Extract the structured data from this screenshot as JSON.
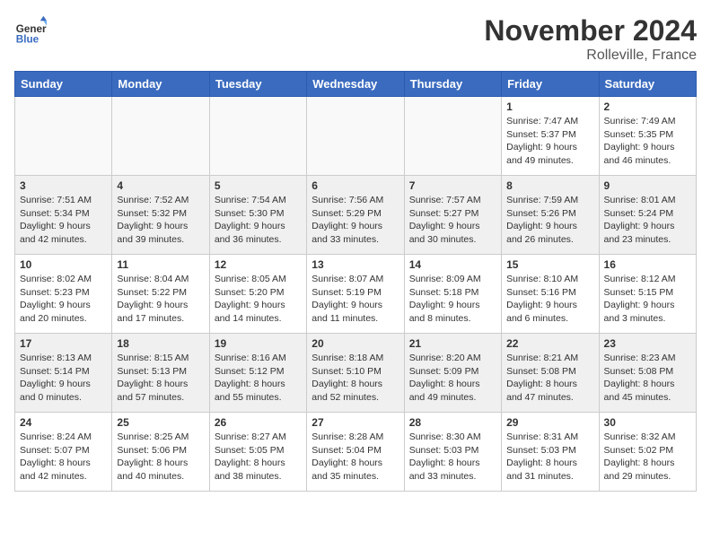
{
  "header": {
    "logo_line1": "General",
    "logo_line2": "Blue",
    "month_title": "November 2024",
    "location": "Rolleville, France"
  },
  "weekdays": [
    "Sunday",
    "Monday",
    "Tuesday",
    "Wednesday",
    "Thursday",
    "Friday",
    "Saturday"
  ],
  "weeks": [
    [
      {
        "day": "",
        "info": ""
      },
      {
        "day": "",
        "info": ""
      },
      {
        "day": "",
        "info": ""
      },
      {
        "day": "",
        "info": ""
      },
      {
        "day": "",
        "info": ""
      },
      {
        "day": "1",
        "info": "Sunrise: 7:47 AM\nSunset: 5:37 PM\nDaylight: 9 hours\nand 49 minutes."
      },
      {
        "day": "2",
        "info": "Sunrise: 7:49 AM\nSunset: 5:35 PM\nDaylight: 9 hours\nand 46 minutes."
      }
    ],
    [
      {
        "day": "3",
        "info": "Sunrise: 7:51 AM\nSunset: 5:34 PM\nDaylight: 9 hours\nand 42 minutes."
      },
      {
        "day": "4",
        "info": "Sunrise: 7:52 AM\nSunset: 5:32 PM\nDaylight: 9 hours\nand 39 minutes."
      },
      {
        "day": "5",
        "info": "Sunrise: 7:54 AM\nSunset: 5:30 PM\nDaylight: 9 hours\nand 36 minutes."
      },
      {
        "day": "6",
        "info": "Sunrise: 7:56 AM\nSunset: 5:29 PM\nDaylight: 9 hours\nand 33 minutes."
      },
      {
        "day": "7",
        "info": "Sunrise: 7:57 AM\nSunset: 5:27 PM\nDaylight: 9 hours\nand 30 minutes."
      },
      {
        "day": "8",
        "info": "Sunrise: 7:59 AM\nSunset: 5:26 PM\nDaylight: 9 hours\nand 26 minutes."
      },
      {
        "day": "9",
        "info": "Sunrise: 8:01 AM\nSunset: 5:24 PM\nDaylight: 9 hours\nand 23 minutes."
      }
    ],
    [
      {
        "day": "10",
        "info": "Sunrise: 8:02 AM\nSunset: 5:23 PM\nDaylight: 9 hours\nand 20 minutes."
      },
      {
        "day": "11",
        "info": "Sunrise: 8:04 AM\nSunset: 5:22 PM\nDaylight: 9 hours\nand 17 minutes."
      },
      {
        "day": "12",
        "info": "Sunrise: 8:05 AM\nSunset: 5:20 PM\nDaylight: 9 hours\nand 14 minutes."
      },
      {
        "day": "13",
        "info": "Sunrise: 8:07 AM\nSunset: 5:19 PM\nDaylight: 9 hours\nand 11 minutes."
      },
      {
        "day": "14",
        "info": "Sunrise: 8:09 AM\nSunset: 5:18 PM\nDaylight: 9 hours\nand 8 minutes."
      },
      {
        "day": "15",
        "info": "Sunrise: 8:10 AM\nSunset: 5:16 PM\nDaylight: 9 hours\nand 6 minutes."
      },
      {
        "day": "16",
        "info": "Sunrise: 8:12 AM\nSunset: 5:15 PM\nDaylight: 9 hours\nand 3 minutes."
      }
    ],
    [
      {
        "day": "17",
        "info": "Sunrise: 8:13 AM\nSunset: 5:14 PM\nDaylight: 9 hours\nand 0 minutes."
      },
      {
        "day": "18",
        "info": "Sunrise: 8:15 AM\nSunset: 5:13 PM\nDaylight: 8 hours\nand 57 minutes."
      },
      {
        "day": "19",
        "info": "Sunrise: 8:16 AM\nSunset: 5:12 PM\nDaylight: 8 hours\nand 55 minutes."
      },
      {
        "day": "20",
        "info": "Sunrise: 8:18 AM\nSunset: 5:10 PM\nDaylight: 8 hours\nand 52 minutes."
      },
      {
        "day": "21",
        "info": "Sunrise: 8:20 AM\nSunset: 5:09 PM\nDaylight: 8 hours\nand 49 minutes."
      },
      {
        "day": "22",
        "info": "Sunrise: 8:21 AM\nSunset: 5:08 PM\nDaylight: 8 hours\nand 47 minutes."
      },
      {
        "day": "23",
        "info": "Sunrise: 8:23 AM\nSunset: 5:08 PM\nDaylight: 8 hours\nand 45 minutes."
      }
    ],
    [
      {
        "day": "24",
        "info": "Sunrise: 8:24 AM\nSunset: 5:07 PM\nDaylight: 8 hours\nand 42 minutes."
      },
      {
        "day": "25",
        "info": "Sunrise: 8:25 AM\nSunset: 5:06 PM\nDaylight: 8 hours\nand 40 minutes."
      },
      {
        "day": "26",
        "info": "Sunrise: 8:27 AM\nSunset: 5:05 PM\nDaylight: 8 hours\nand 38 minutes."
      },
      {
        "day": "27",
        "info": "Sunrise: 8:28 AM\nSunset: 5:04 PM\nDaylight: 8 hours\nand 35 minutes."
      },
      {
        "day": "28",
        "info": "Sunrise: 8:30 AM\nSunset: 5:03 PM\nDaylight: 8 hours\nand 33 minutes."
      },
      {
        "day": "29",
        "info": "Sunrise: 8:31 AM\nSunset: 5:03 PM\nDaylight: 8 hours\nand 31 minutes."
      },
      {
        "day": "30",
        "info": "Sunrise: 8:32 AM\nSunset: 5:02 PM\nDaylight: 8 hours\nand 29 minutes."
      }
    ]
  ]
}
